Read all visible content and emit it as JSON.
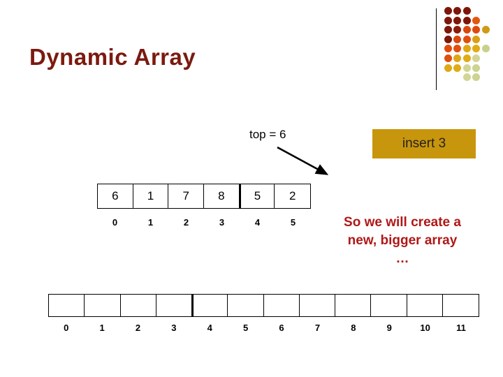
{
  "slide": {
    "title": "Dynamic Array",
    "title_color": "#7B1A10",
    "background": "#ffffff"
  },
  "decoration": {
    "name": "dot-grid",
    "rule_color": "#000000",
    "rows": [
      [
        "#7E1509",
        "#7E1509",
        "#7E1509"
      ],
      [
        "#7E1509",
        "#7E1509",
        "#7E1509",
        "#E3570F"
      ],
      [
        "#7E1509",
        "#8C1B09",
        "#D8480D",
        "#DC4A0D",
        "#D09A12"
      ],
      [
        "#7E1509",
        "#D8480D",
        "#DF4F0E",
        "#D9A013"
      ],
      [
        "#DE4B0D",
        "#DF4F0E",
        "#E0A615",
        "#DFAC16",
        "#C9D08A"
      ],
      [
        "#DF4F0E",
        "#E0A615",
        "#DFAC16",
        "#D3D596"
      ],
      [
        "#DFA815",
        "#DFAC16",
        "#D3D596",
        "#CDD391"
      ],
      [
        "#D3D596",
        "#CDD391"
      ]
    ]
  },
  "pointer": {
    "label": "top = 6",
    "arrow_name": "pointer-arrow",
    "arrow_color": "#000000"
  },
  "insert_action": {
    "label": "insert 3",
    "background": "#C8960C",
    "text_color": "#231F20"
  },
  "top_array": {
    "name": "current-array",
    "values": [
      "6",
      "1",
      "7",
      "8",
      "5",
      "2"
    ],
    "indices": [
      "0",
      "1",
      "2",
      "3",
      "4",
      "5"
    ],
    "thick_divider_before_index": 4
  },
  "bottom_array": {
    "name": "new-bigger-array",
    "values": [
      "",
      "",
      "",
      "",
      "",
      "",
      "",
      "",
      "",
      "",
      "",
      ""
    ],
    "indices": [
      "0",
      "1",
      "2",
      "3",
      "4",
      "5",
      "6",
      "7",
      "8",
      "9",
      "10",
      "11"
    ],
    "thick_divider_before_index": 4
  },
  "narration": {
    "color": "#B01818",
    "lines": [
      "So we will create a",
      "new, bigger array",
      "…"
    ]
  }
}
